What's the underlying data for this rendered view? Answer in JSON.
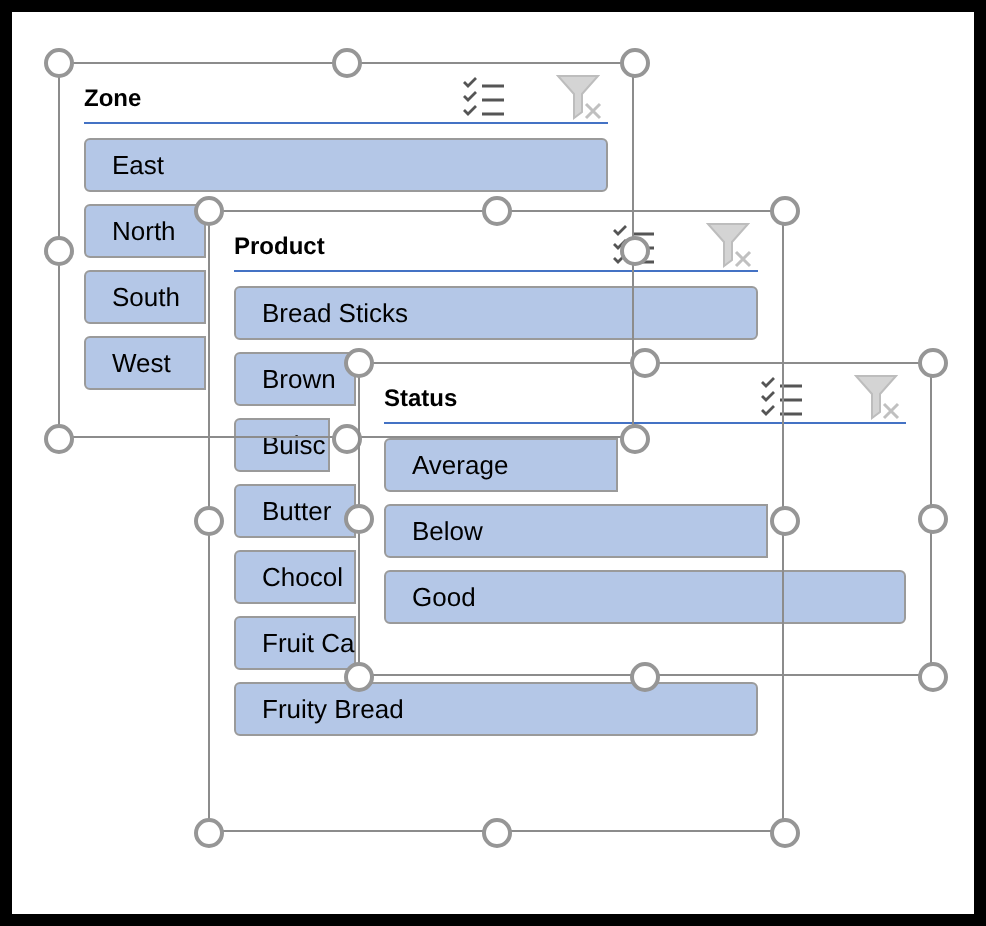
{
  "slicers": [
    {
      "title": "Zone",
      "items": [
        {
          "label": "East",
          "selected": true
        },
        {
          "label": "North",
          "selected": true
        },
        {
          "label": "South",
          "selected": true
        },
        {
          "label": "West",
          "selected": true
        }
      ]
    },
    {
      "title": "Product",
      "items": [
        {
          "label": "Bread Sticks",
          "selected": true
        },
        {
          "label": "Brown",
          "selected": true
        },
        {
          "label": "Buisc",
          "selected": true
        },
        {
          "label": "Butter",
          "selected": true
        },
        {
          "label": "Chocol",
          "selected": true
        },
        {
          "label": "Fruit Ca",
          "selected": true
        },
        {
          "label": "Fruity Bread",
          "selected": true
        }
      ]
    },
    {
      "title": "Status",
      "items": [
        {
          "label": "Average",
          "selected": true
        },
        {
          "label": "Below",
          "selected": true
        },
        {
          "label": "Good",
          "selected": true
        }
      ]
    }
  ]
}
